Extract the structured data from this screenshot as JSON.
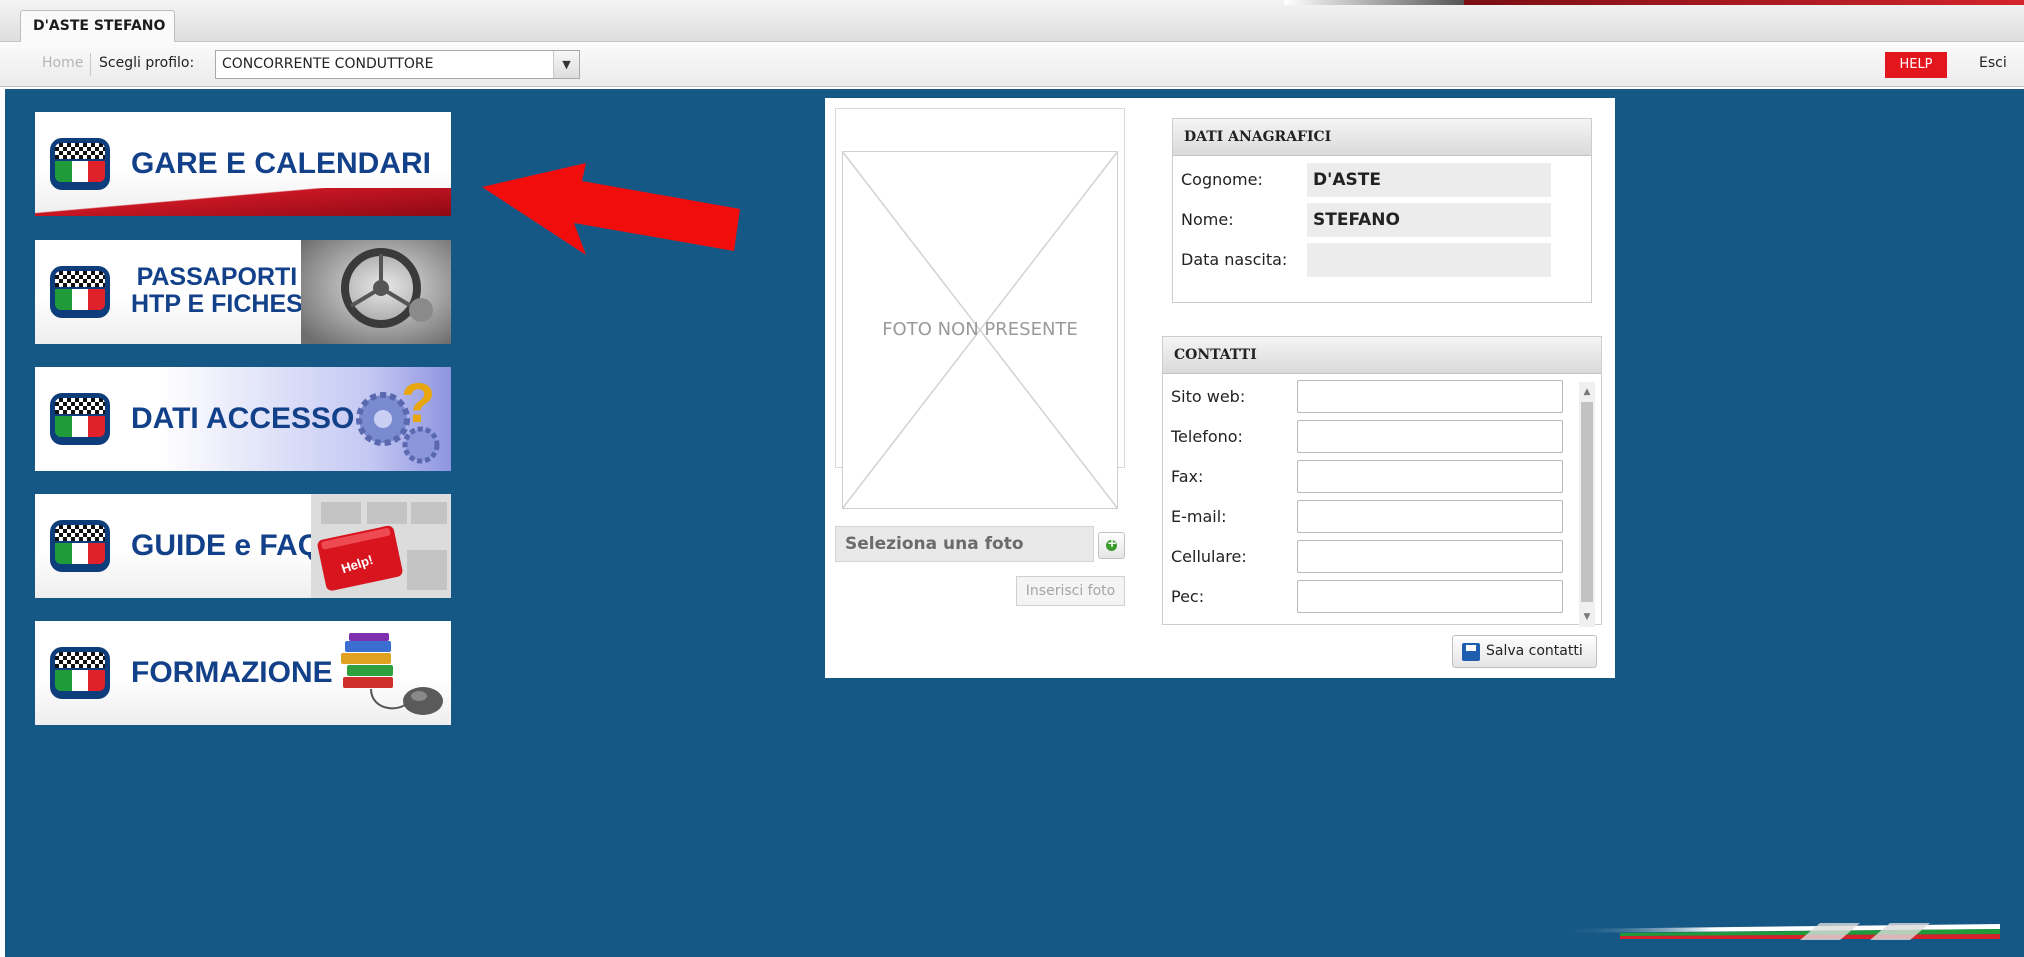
{
  "window": {
    "tab_title": "D'ASTE STEFANO"
  },
  "toolbar": {
    "home_label": "Home",
    "profile_label": "Scegli profilo:",
    "profile_value": "CONCORRENTE CONDUTTORE",
    "help_label": "HELP",
    "exit_label": "Esci"
  },
  "menu": {
    "items": [
      {
        "id": "gare",
        "lines": [
          "GARE E CALENDARI"
        ]
      },
      {
        "id": "passaporti",
        "lines": [
          "PASSAPORTI",
          "HTP E FICHES"
        ]
      },
      {
        "id": "accesso",
        "lines": [
          "DATI ACCESSO"
        ]
      },
      {
        "id": "guide",
        "lines": [
          "GUIDE e FAQ"
        ],
        "art_text": "Help!"
      },
      {
        "id": "formazione",
        "lines": [
          "FORMAZIONE"
        ]
      }
    ],
    "flag_colors": {
      "green": "#1f9b3a",
      "white": "#ffffff",
      "red": "#e0202a",
      "frame": "#0d3d7a"
    }
  },
  "photo": {
    "placeholder": "FOTO NON PRESENTE",
    "select_label": "Seleziona una foto",
    "insert_label": "Inserisci foto"
  },
  "anagrafica": {
    "title": "DATI ANAGRAFICI",
    "fields": [
      {
        "label": "Cognome:",
        "value": "D'ASTE"
      },
      {
        "label": "Nome:",
        "value": "STEFANO"
      },
      {
        "label": "Data nascita:",
        "value": ""
      }
    ]
  },
  "contatti": {
    "title": "CONTATTI",
    "fields": [
      {
        "label": "Sito web:",
        "value": ""
      },
      {
        "label": "Telefono:",
        "value": ""
      },
      {
        "label": "Fax:",
        "value": ""
      },
      {
        "label": "E-mail:",
        "value": ""
      },
      {
        "label": "Cellulare:",
        "value": ""
      },
      {
        "label": "Pec:",
        "value": ""
      }
    ],
    "save_label": "Salva contatti"
  },
  "colors": {
    "background": "#165885",
    "accent_red": "#e4161d",
    "arrow": "#f20d0d",
    "tile_text": "#12418a"
  }
}
